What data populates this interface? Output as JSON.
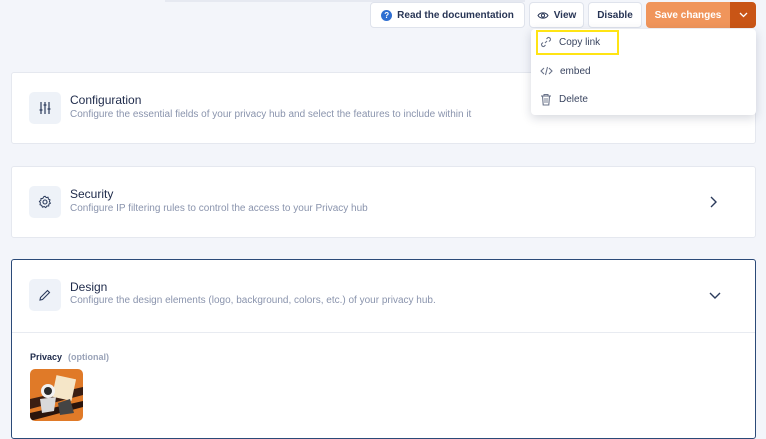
{
  "toolbar": {
    "docs_label": "Read the documentation",
    "view_label": "View",
    "disable_label": "Disable",
    "save_label": "Save changes"
  },
  "sections": {
    "configuration": {
      "title": "Configuration",
      "description": "Configure the essential fields of your privacy hub and select the features to include within it"
    },
    "security": {
      "title": "Security",
      "description": "Configure IP filtering rules to control the access to your Privacy hub"
    },
    "design": {
      "title": "Design",
      "description": "Configure the design elements (logo, background, colors, etc.) of your privacy hub.",
      "field_label": "Privacy",
      "field_optional": "(optional)"
    }
  },
  "dropdown": {
    "copy_link": "Copy link",
    "embed": "embed",
    "delete": "Delete"
  },
  "colors": {
    "accent_save": "#f0955b",
    "accent_save_dark": "#c95516",
    "active_border": "#2b4a78",
    "highlight": "#ffe414"
  }
}
